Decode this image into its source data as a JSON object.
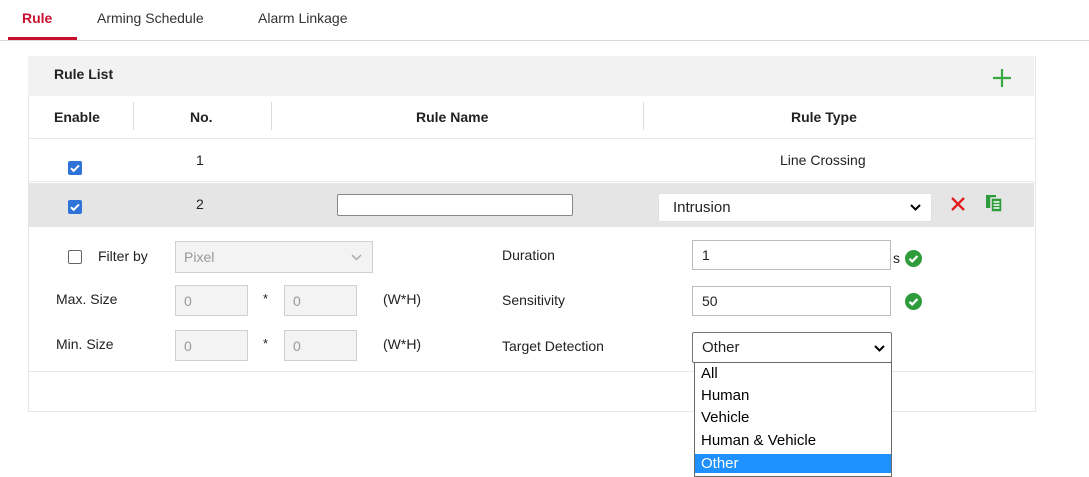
{
  "tabs": [
    {
      "label": "Rule",
      "active": true
    },
    {
      "label": "Arming Schedule",
      "active": false
    },
    {
      "label": "Alarm Linkage",
      "active": false
    }
  ],
  "rule_list": {
    "title": "Rule List",
    "add_icon": "plus-icon",
    "columns": [
      "Enable",
      "No.",
      "Rule Name",
      "Rule Type"
    ],
    "rows": [
      {
        "enabled": true,
        "no": "1",
        "name": "",
        "type": "Line Crossing"
      },
      {
        "enabled": true,
        "no": "2",
        "name": "",
        "type": "Intrusion",
        "editing": true
      }
    ],
    "row_actions": [
      "delete-icon",
      "copy-icon"
    ]
  },
  "settings": {
    "filter_by_label": "Filter by",
    "filter_by_checked": false,
    "filter_by_value": "Pixel",
    "max_size_label": "Max. Size",
    "max_size_w": "0",
    "max_size_h": "0",
    "min_size_label": "Min. Size",
    "min_size_w": "0",
    "min_size_h": "0",
    "times": "*",
    "wh_label": "(W*H)",
    "duration_label": "Duration",
    "duration_value": "1",
    "duration_unit": "s",
    "sensitivity_label": "Sensitivity",
    "sensitivity_value": "50",
    "target_detection_label": "Target Detection",
    "target_detection_value": "Other",
    "target_detection_options": [
      "All",
      "Human",
      "Vehicle",
      "Human & Vehicle",
      "Other"
    ],
    "target_detection_highlighted": "Other"
  },
  "colors": {
    "accent": "#c8102e",
    "checkbox": "#2f73d9",
    "ok_green": "#2e9c3a",
    "delete_red": "#e02020",
    "selection_blue": "#1e90ff"
  }
}
